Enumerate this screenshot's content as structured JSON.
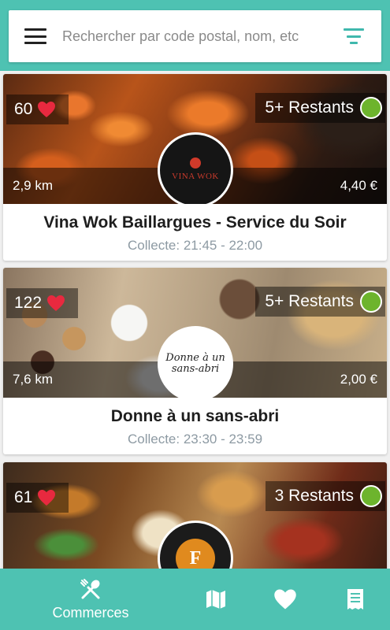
{
  "search": {
    "placeholder": "Rechercher par code postal, nom, etc"
  },
  "stores": [
    {
      "name": "Vina Wok Baillargues - Service du Soir",
      "pickup": "Collecte: 21:45 - 22:00",
      "favorites": "60",
      "stock": "5+ Restants",
      "distance": "2,9 km",
      "price": "4,40 €",
      "logo_text": "VINA WOK"
    },
    {
      "name": "Donne à un sans-abri",
      "pickup": "Collecte: 23:30 - 23:59",
      "favorites": "122",
      "stock": "5+ Restants",
      "distance": "7,6 km",
      "price": "2,00 €",
      "logo_text": "Donne à un sans-abri"
    },
    {
      "name": "",
      "pickup": "",
      "favorites": "61",
      "stock": "3 Restants",
      "distance": "",
      "price": "",
      "logo_text": "Les Fromentiers"
    }
  ],
  "nav": {
    "active_label": "Commerces",
    "items": [
      "store-icon",
      "map-icon",
      "heart-icon",
      "receipt-icon"
    ]
  },
  "colors": {
    "accent": "#4ec2b2",
    "available": "#6db42d",
    "heart": "#e8293f"
  }
}
